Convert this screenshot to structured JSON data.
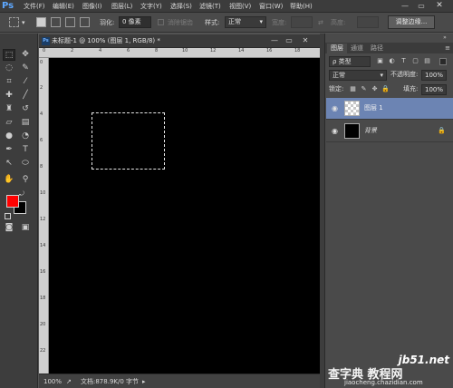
{
  "app": {
    "logo": "Ps"
  },
  "menu": [
    "文件(F)",
    "编辑(E)",
    "图像(I)",
    "图层(L)",
    "文字(Y)",
    "选择(S)",
    "滤镜(T)",
    "视图(V)",
    "窗口(W)",
    "帮助(H)"
  ],
  "window_controls": {
    "minimize": "—",
    "maximize": "▭",
    "close": "✕"
  },
  "options_bar": {
    "feather_label": "羽化:",
    "feather_value": "0 像素",
    "antialias_label": "消除锯齿",
    "style_label": "样式:",
    "style_value": "正常",
    "width_label": "宽度:",
    "height_label": "高度:",
    "refine_edge_button": "调整边缘..."
  },
  "document": {
    "title": "未标题-1 @ 100% (图层 1, RGB/8) *",
    "zoom": "100%",
    "doc_info": "文档:878.9K/0 字节",
    "ruler_top_labels": [
      "0",
      "2",
      "4",
      "6",
      "8",
      "10",
      "12",
      "14",
      "16",
      "18"
    ],
    "ruler_left_labels": [
      "0",
      "2",
      "4",
      "6",
      "8",
      "10",
      "12",
      "14",
      "16",
      "18",
      "20",
      "22"
    ],
    "selection": {
      "type": "rectangular-marquee"
    }
  },
  "tools": {
    "foreground_color": "#ff0000",
    "background_color": "#000000"
  },
  "layers_panel": {
    "tabs": [
      "图层",
      "通道",
      "路径"
    ],
    "filter_label": "ρ 类型",
    "blend_mode": "正常",
    "opacity_label": "不透明度:",
    "opacity_value": "100%",
    "lock_label": "锁定:",
    "fill_label": "填充:",
    "fill_value": "100%",
    "layers": [
      {
        "name": "图层 1",
        "selected": true,
        "thumbnail": "transparent"
      },
      {
        "name": "背景",
        "selected": false,
        "thumbnail": "black",
        "locked": true
      }
    ]
  },
  "watermark": {
    "site": "jb51.net",
    "line1": "查字典 教程网",
    "line2": "jiaocheng.chazidian.com"
  }
}
